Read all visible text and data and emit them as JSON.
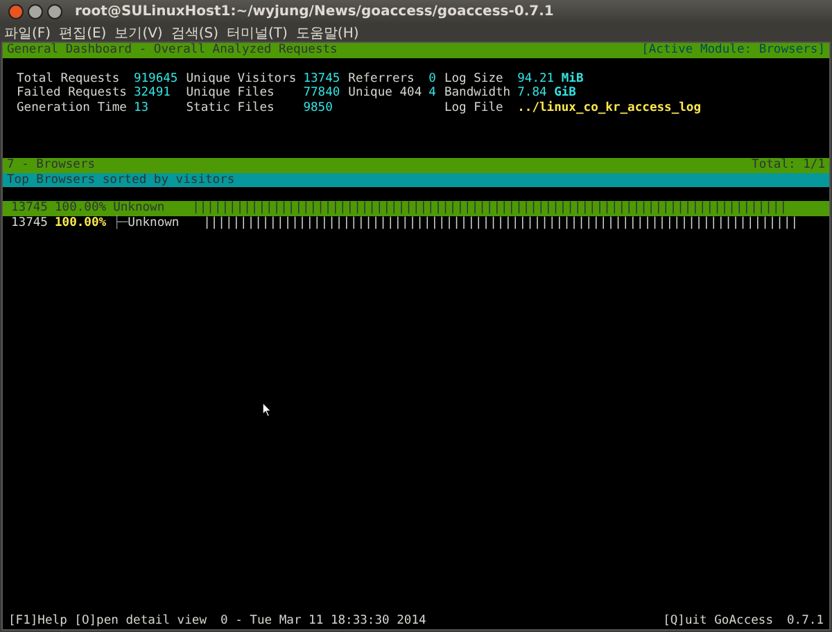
{
  "window": {
    "title": "root@SULinuxHost1:~/wyjung/News/goaccess/goaccess-0.7.1"
  },
  "menu": [
    "파일(F)",
    "편집(E)",
    "보기(V)",
    "검색(S)",
    "터미널(T)",
    "도움말(H)"
  ],
  "header": {
    "title": "General Dashboard - Overall Analyzed Requests",
    "module": "[Active Module: Browsers]"
  },
  "stats": [
    {
      "items": [
        {
          "label": "Total Requests",
          "value": "919645",
          "kind": "count"
        },
        {
          "label": "Failed Requests",
          "value": "32491",
          "kind": "count"
        },
        {
          "label": "Generation Time",
          "value": "13",
          "kind": "count"
        }
      ]
    },
    {
      "items": [
        {
          "label": "Unique Visitors",
          "value": "13745",
          "kind": "count"
        },
        {
          "label": "Unique Files",
          "value": "77840",
          "kind": "count"
        },
        {
          "label": "Static Files",
          "value": "9850",
          "kind": "count"
        }
      ]
    },
    {
      "items": [
        {
          "label": "Referrers",
          "value": "0",
          "kind": "count"
        },
        {
          "label": "Unique 404",
          "value": "4",
          "kind": "count"
        }
      ]
    },
    {
      "items": [
        {
          "label": "Log Size",
          "value": "94.21 **MiB**",
          "kind": "count"
        },
        {
          "label": "Bandwidth",
          "value": "7.84 **GiB**",
          "kind": "count"
        },
        {
          "label": "Log File",
          "value": "../linux_co_kr_access_log",
          "kind": "path"
        }
      ]
    }
  ],
  "panel": {
    "title": "7 - Browsers",
    "total": "Total: 1/1",
    "subtitle": "Top Browsers sorted by visitors"
  },
  "rows": [
    {
      "hits": "13745",
      "percent": "100.00%",
      "name": "Unknown",
      "selected": true,
      "kind": "item",
      "bar": "|||||||||||||||||||||||||||||||||||||||||||||||||||||||||||||||||||||||||||||||||"
    },
    {
      "hits": "13745",
      "percent": "100.00%",
      "branch": "├─",
      "name": "Unknown",
      "selected": false,
      "kind": "child",
      "bar": "|||||||||||||||||||||||||||||||||||||||||||||||||||||||||||||||||||||||||||||||||"
    }
  ],
  "footer": {
    "help": "[F1]Help [O]pen detail view",
    "time": "0 - Tue Mar 11 18:33:30 2014",
    "quit": "[Q]uit GoAccess",
    "version": "0.7.1"
  }
}
